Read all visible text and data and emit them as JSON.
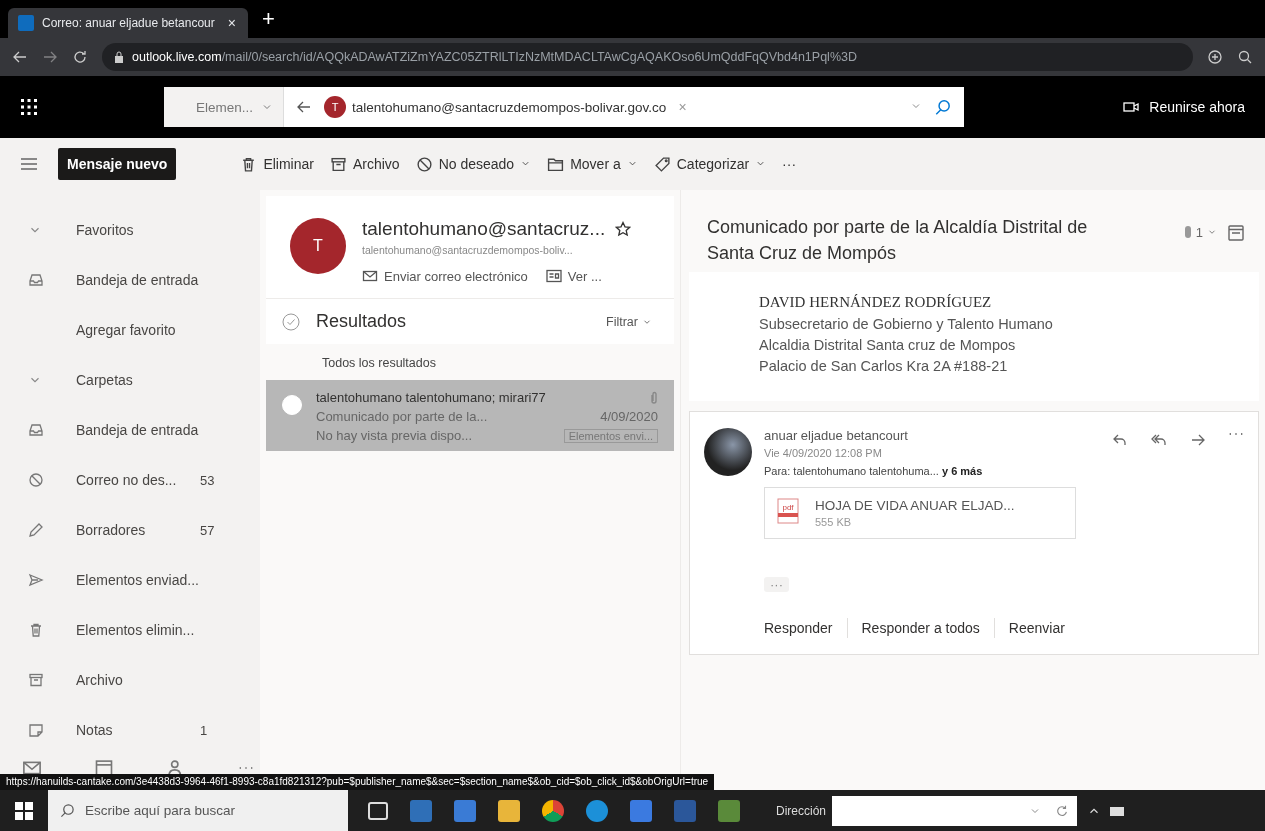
{
  "browser": {
    "tab_title": "Correo: anuar eljadue betancour",
    "tab_close": "×",
    "new_tab": "+",
    "url_host": "outlook.live.com",
    "url_path": "/mail/0/search/id/AQQkADAwATZiZmYAZC05ZTRlLTIzNzMtMDACLTAwCgAQAKOso6UmQddFqQVbd4n1Pql%3D"
  },
  "header": {
    "scope": "Elemen...",
    "search_chip": "talentohumano@santacruzdemompos-bolivar.gov.co",
    "chip_avatar": "T",
    "chip_close": "×",
    "meet": "Reunirse ahora"
  },
  "toolbar": {
    "new_message": "Mensaje nuevo",
    "more": "···",
    "actions": [
      {
        "label": "Eliminar",
        "kind": "trash",
        "dropdown": false
      },
      {
        "label": "Archivo",
        "kind": "archive",
        "dropdown": false
      },
      {
        "label": "No deseado",
        "kind": "block",
        "dropdown": true
      },
      {
        "label": "Mover a",
        "kind": "move",
        "dropdown": true
      },
      {
        "label": "Categorizar",
        "kind": "tag",
        "dropdown": true
      }
    ]
  },
  "sidebar": {
    "sections": [
      {
        "label": "Favoritos",
        "expanded": true,
        "items": [
          {
            "label": "Bandeja de entrada",
            "kind": "inbox"
          },
          {
            "label": "Agregar favorito",
            "kind": "link"
          }
        ]
      },
      {
        "label": "Carpetas",
        "expanded": true,
        "items": [
          {
            "label": "Bandeja de entrada",
            "kind": "inbox"
          },
          {
            "label": "Correo no des...",
            "kind": "block",
            "count": "53"
          },
          {
            "label": "Borradores",
            "kind": "pencil",
            "count": "57"
          },
          {
            "label": "Elementos enviad...",
            "kind": "send"
          },
          {
            "label": "Elementos elimin...",
            "kind": "trash"
          },
          {
            "label": "Archivo",
            "kind": "archive"
          },
          {
            "label": "Notas",
            "kind": "note",
            "count": "1"
          }
        ]
      }
    ]
  },
  "contact": {
    "avatar": "T",
    "name": "talentohumano@santacruz...",
    "email": "talentohumano@santacruzdemompos-boliv...",
    "send_email": "Enviar correo electrónico",
    "view": "Ver ..."
  },
  "results": {
    "title": "Resultados",
    "select_all_checked": false,
    "filter": "Filtrar",
    "group": "Todos los resultados"
  },
  "messages": [
    {
      "from": "talentohumano talentohumano; mirari77",
      "subject": "Comunicado por parte de la...",
      "date": "4/09/2020",
      "preview": "No hay vista previa dispo...",
      "folder": "Elementos envi...",
      "selected": true,
      "has_attachment": true
    }
  ],
  "reading": {
    "subject": "Comunicado por parte de la Alcaldía Distrital de Santa Cruz de Mompós",
    "attachment_count": "1",
    "signature": [
      "DAVID HERNÁNDEZ RODRÍGUEZ",
      "Subsecretario de Gobierno y Talento Humano",
      "Alcaldia Distrital Santa cruz de Mompos",
      "Palacio de San Carlos Kra 2A #188-21"
    ],
    "message": {
      "sender": "anuar eljadue betancourt",
      "date": "Vie 4/09/2020 12:08 PM",
      "to_label": "Para:",
      "to": "talentohumano talentohuma...",
      "more_recipients": "y 6 más",
      "ellipsis": "···",
      "attachment": {
        "name": "HOJA DE VIDA ANUAR ELJAD...",
        "size": "555 KB",
        "icon_text": "pdf"
      },
      "actions": [
        "Responder",
        "Responder a todos",
        "Reenviar"
      ]
    }
  },
  "status_url": "https://hanuilds-cantake.com/3e4438d3-9964-46f1-8993-c8a1fd821312?pub=$publisher_name$&sec=$section_name$&ob_cid=$ob_click_id$&obOrigUrl=true",
  "taskbar": {
    "search_placeholder": "Escribe aquí para buscar",
    "address_label": "Dirección"
  }
}
